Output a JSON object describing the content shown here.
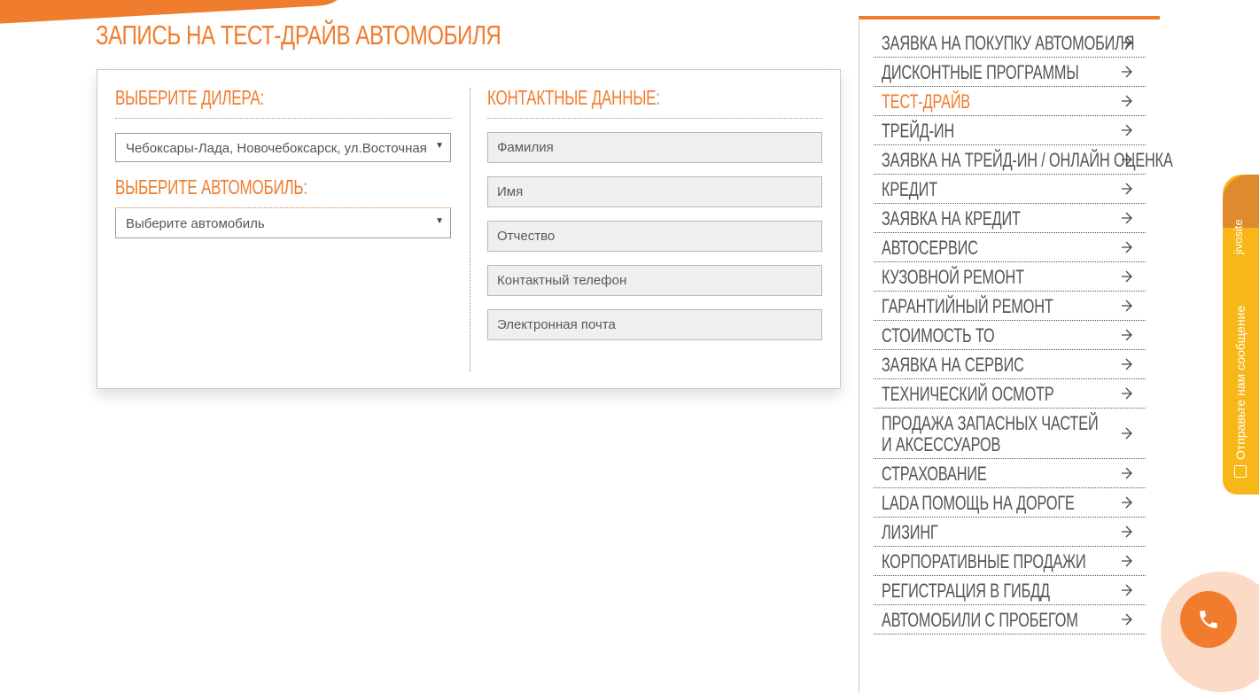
{
  "page": {
    "title": "ЗАПИСЬ НА ТЕСТ-ДРАЙВ АВТОМОБИЛЯ"
  },
  "form": {
    "dealer_section_title": "ВЫБЕРИТЕ ДИЛЕРА:",
    "dealer_selected": "Чебоксары-Лада, Новочебоксарск, ул.Восточная",
    "car_section_title": "ВЫБЕРИТЕ АВТОМОБИЛЬ:",
    "car_selected": "Выберите автомобиль",
    "contact_section_title": "КОНТАКТНЫЕ ДАННЫЕ:",
    "fields": {
      "last_name_placeholder": "Фамилия",
      "first_name_placeholder": "Имя",
      "patronymic_placeholder": "Отчество",
      "phone_placeholder": "Контактный телефон",
      "email_placeholder": "Электронная почта"
    }
  },
  "sidebar": {
    "active_item": "ТЕСТ-ДРАЙВ",
    "items": [
      "ЗАЯВКА НА ПОКУПКУ АВТОМОБИЛЯ",
      "ДИСКОНТНЫЕ ПРОГРАММЫ",
      "ТЕСТ-ДРАЙВ",
      "ТРЕЙД-ИН",
      "ЗАЯВКА НА ТРЕЙД-ИН / ОНЛАЙН ОЦЕНКА",
      "КРЕДИТ",
      "ЗАЯВКА НА КРЕДИТ",
      "АВТОСЕРВИС",
      "КУЗОВНОЙ РЕМОНТ",
      "ГАРАНТИЙНЫЙ РЕМОНТ",
      "СТОИМОСТЬ ТО",
      "ЗАЯВКА НА СЕРВИС",
      "ТЕХНИЧЕСКИЙ ОСМОТР",
      "ПРОДАЖА ЗАПАСНЫХ ЧАСТЕЙ И АКСЕССУАРОВ",
      "СТРАХОВАНИЕ",
      "LADA ПОМОЩЬ НА ДОРОГЕ",
      "ЛИЗИНГ",
      "КОРПОРАТИВНЫЕ ПРОДАЖИ",
      "РЕГИСТРАЦИЯ В ГИБДД",
      "АВТОМОБИЛИ С ПРОБЕГОМ"
    ]
  },
  "chat_widget": {
    "brand": "jivosite",
    "label": "Отправьте нам сообщение"
  },
  "icons": {
    "menu_arrow": "arrow-right-icon",
    "chat": "message-icon",
    "callback": "phone-icon",
    "select_caret": "caret-down-icon"
  },
  "colors": {
    "accent": "#f07c2e",
    "chat_tab": "#f7b718",
    "text": "#555555"
  }
}
